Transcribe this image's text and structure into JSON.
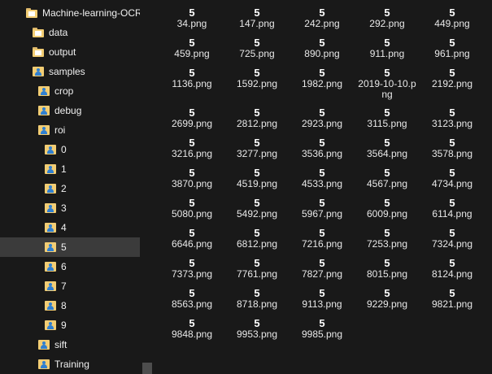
{
  "navigation": {
    "items": [
      {
        "label": "Machine-learning-OCR",
        "icon": "folder-icon"
      },
      {
        "label": "data",
        "icon": "folder-icon"
      },
      {
        "label": "output",
        "icon": "folder-icon"
      },
      {
        "label": "samples",
        "icon": "user-folder-icon"
      },
      {
        "label": "crop",
        "icon": "user-folder-icon"
      },
      {
        "label": "debug",
        "icon": "user-folder-icon"
      },
      {
        "label": "roi",
        "icon": "user-folder-icon"
      },
      {
        "label": "0",
        "icon": "user-folder-icon"
      },
      {
        "label": "1",
        "icon": "user-folder-icon"
      },
      {
        "label": "2",
        "icon": "user-folder-icon"
      },
      {
        "label": "3",
        "icon": "user-folder-icon"
      },
      {
        "label": "4",
        "icon": "user-folder-icon"
      },
      {
        "label": "5",
        "icon": "user-folder-icon",
        "selected": true
      },
      {
        "label": "6",
        "icon": "user-folder-icon"
      },
      {
        "label": "7",
        "icon": "user-folder-icon"
      },
      {
        "label": "8",
        "icon": "user-folder-icon"
      },
      {
        "label": "9",
        "icon": "user-folder-icon"
      },
      {
        "label": "sift",
        "icon": "user-folder-icon"
      },
      {
        "label": "Training",
        "icon": "user-folder-icon"
      }
    ]
  },
  "files": {
    "thumbnail_glyph": "5",
    "items": [
      "34.png",
      "147.png",
      "242.png",
      "292.png",
      "449.png",
      "459.png",
      "725.png",
      "890.png",
      "911.png",
      "961.png",
      "1136.png",
      "1592.png",
      "1982.png",
      "2019-10-10.png",
      "2192.png",
      "2699.png",
      "2812.png",
      "2923.png",
      "3115.png",
      "3123.png",
      "3216.png",
      "3277.png",
      "3536.png",
      "3564.png",
      "3578.png",
      "3870.png",
      "4519.png",
      "4533.png",
      "4567.png",
      "4734.png",
      "5080.png",
      "5492.png",
      "5967.png",
      "6009.png",
      "6114.png",
      "6646.png",
      "6812.png",
      "7216.png",
      "7253.png",
      "7324.png",
      "7373.png",
      "7761.png",
      "7827.png",
      "8015.png",
      "8124.png",
      "8563.png",
      "8718.png",
      "9113.png",
      "9229.png",
      "9821.png",
      "9848.png",
      "9953.png",
      "9985.png"
    ]
  },
  "colors": {
    "background": "#191919",
    "selected_row": "#3b3b3b",
    "folder": "#f2cd74",
    "user_badge": "#2f7fd1"
  }
}
